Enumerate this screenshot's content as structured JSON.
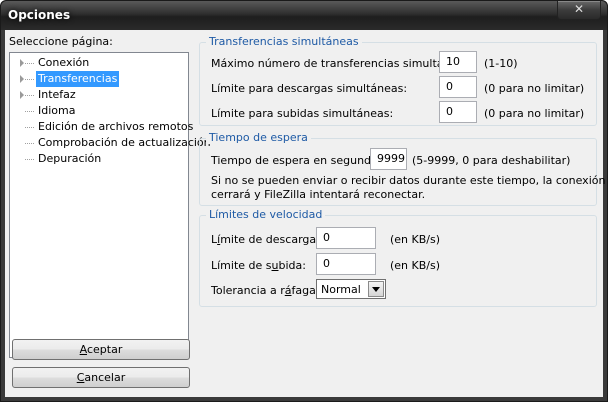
{
  "window": {
    "title": "Opciones"
  },
  "sidebar": {
    "heading": "Seleccione página:",
    "items": [
      {
        "label": "Conexión",
        "expandable": true
      },
      {
        "label": "Transferencias",
        "expandable": true,
        "selected": true
      },
      {
        "label": "Intefaz",
        "expandable": true
      },
      {
        "label": "Idioma",
        "expandable": false
      },
      {
        "label": "Edición de archivos remotos",
        "expandable": false
      },
      {
        "label": "Comprobación de actualización",
        "expandable": false
      },
      {
        "label": "Depuración",
        "expandable": false
      }
    ],
    "ok_label_pre": "",
    "ok_label_u": "A",
    "ok_label_post": "ceptar",
    "cancel_label_pre": "",
    "cancel_label_u": "C",
    "cancel_label_post": "ancelar"
  },
  "transfers": {
    "title": "Transferencias simultáneas",
    "max_label": "Máximo número de transferencias simultáneas:",
    "max_value": "10",
    "max_hint": "(1-10)",
    "downloads_label": "Límite para descargas simultáneas:",
    "downloads_value": "0",
    "downloads_hint": "(0 para no limitar)",
    "uploads_label": "Límite para subidas simultáneas:",
    "uploads_value": "0",
    "uploads_hint": "(0 para no limitar)"
  },
  "timeout": {
    "title": "Tiempo de espera",
    "label": "Tiempo de espera en segundos:",
    "value": "9999",
    "hint": "(5-9999, 0 para deshabilitar)",
    "note_line1": "Si no se pueden enviar o recibir datos durante este tiempo, la conexión se",
    "note_line2": "cerrará y FileZilla intentará reconectar."
  },
  "speed": {
    "title": "Límites de velocidad",
    "download_label_pre": "L",
    "download_label_u": "í",
    "download_label_post": "mite de descarga:",
    "download_value": "0",
    "download_unit": "(en KB/s)",
    "upload_label_pre": "Límite de s",
    "upload_label_u": "u",
    "upload_label_post": "bida:",
    "upload_value": "0",
    "upload_unit": "(en KB/s)",
    "burst_label_pre": "Tolerancia a r",
    "burst_label_u": "á",
    "burst_label_post": "fagas:",
    "burst_value": "Normal"
  }
}
